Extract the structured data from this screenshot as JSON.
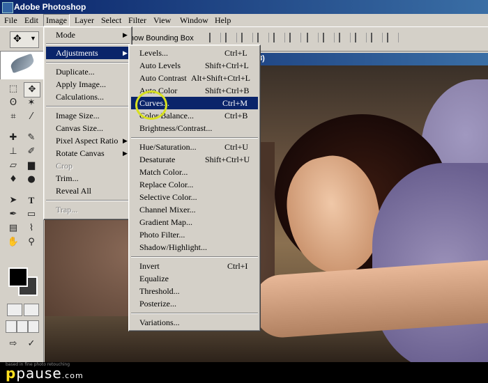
{
  "window": {
    "title": "Adobe Photoshop"
  },
  "menubar": [
    "File",
    "Edit",
    "Image",
    "Layer",
    "Select",
    "Filter",
    "View",
    "Window",
    "Help"
  ],
  "options_bar": {
    "show_bounding_box_label": "how Bounding Box"
  },
  "canvas_title_fragment": "8)",
  "image_menu": {
    "items": [
      {
        "label": "Mode",
        "submenu": true
      },
      {
        "label": "Adjustments",
        "submenu": true,
        "highlighted": true
      },
      {
        "label": "Duplicate..."
      },
      {
        "label": "Apply Image..."
      },
      {
        "label": "Calculations..."
      },
      {
        "label": "Image Size..."
      },
      {
        "label": "Canvas Size..."
      },
      {
        "label": "Pixel Aspect Ratio",
        "submenu": true
      },
      {
        "label": "Rotate Canvas",
        "submenu": true
      },
      {
        "label": "Crop",
        "disabled": true
      },
      {
        "label": "Trim..."
      },
      {
        "label": "Reveal All"
      },
      {
        "label": "Trap...",
        "disabled": true
      }
    ]
  },
  "adjustments_menu": {
    "items": [
      {
        "label": "Levels...",
        "shortcut": "Ctrl+L"
      },
      {
        "label": "Auto Levels",
        "shortcut": "Shift+Ctrl+L"
      },
      {
        "label": "Auto Contrast",
        "shortcut": "Alt+Shift+Ctrl+L"
      },
      {
        "label": "Auto Color",
        "shortcut": "Shift+Ctrl+B"
      },
      {
        "label": "Curves...",
        "shortcut": "Ctrl+M",
        "highlighted": true
      },
      {
        "label": "Color Balance...",
        "shortcut": "Ctrl+B"
      },
      {
        "label": "Brightness/Contrast..."
      },
      {
        "label": "Hue/Saturation...",
        "shortcut": "Ctrl+U"
      },
      {
        "label": "Desaturate",
        "shortcut": "Shift+Ctrl+U"
      },
      {
        "label": "Match Color..."
      },
      {
        "label": "Replace Color..."
      },
      {
        "label": "Selective Color..."
      },
      {
        "label": "Channel Mixer..."
      },
      {
        "label": "Gradient Map..."
      },
      {
        "label": "Photo Filter..."
      },
      {
        "label": "Shadow/Highlight..."
      },
      {
        "label": "Invert",
        "shortcut": "Ctrl+I"
      },
      {
        "label": "Equalize"
      },
      {
        "label": "Threshold..."
      },
      {
        "label": "Posterize..."
      },
      {
        "label": "Variations..."
      }
    ]
  },
  "footer": {
    "brand_p": "p",
    "brand_rest": "pause",
    "brand_dotcom": ".com",
    "tagline": "based in fine photo retouching"
  },
  "colors": {
    "menu_highlight": "#0a246a",
    "circle_annotation": "#d8e020"
  }
}
